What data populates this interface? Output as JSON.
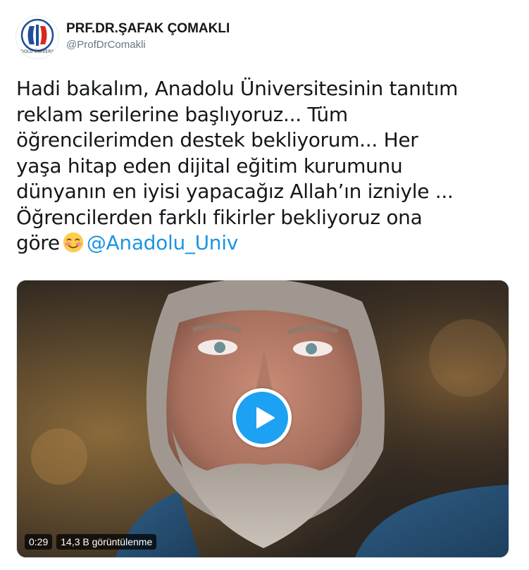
{
  "author": {
    "display_name": "PRF.DR.ŞAFAK ÇOMAKLI",
    "handle": "@ProfDrComakli",
    "avatar_caption": "DOLU ÜNİVERS",
    "avatar_icon": "anadolu-university-logo"
  },
  "tweet": {
    "text_lines": [
      "Hadi bakalım, Anadolu Üniversitesinin tanıtım",
      "reklam serilerine başlıyoruz... Tüm",
      "öğrencilerimden destek bekliyorum... Her",
      "yaşa hitap eden dijital eğitim kurumunu",
      "dünyanın en iyisi yapacağız Allah’ın izniyle ...",
      "Öğrencilerden farklı fikirler bekliyoruz ona"
    ],
    "last_line_start": "göre",
    "emoji": "smiling-face-with-blush",
    "mention": "@Anadolu_Univ"
  },
  "video": {
    "duration": "0:29",
    "views": "14,3 B görüntülenme",
    "play_icon": "play-icon",
    "accent_color": "#1da1f2"
  }
}
